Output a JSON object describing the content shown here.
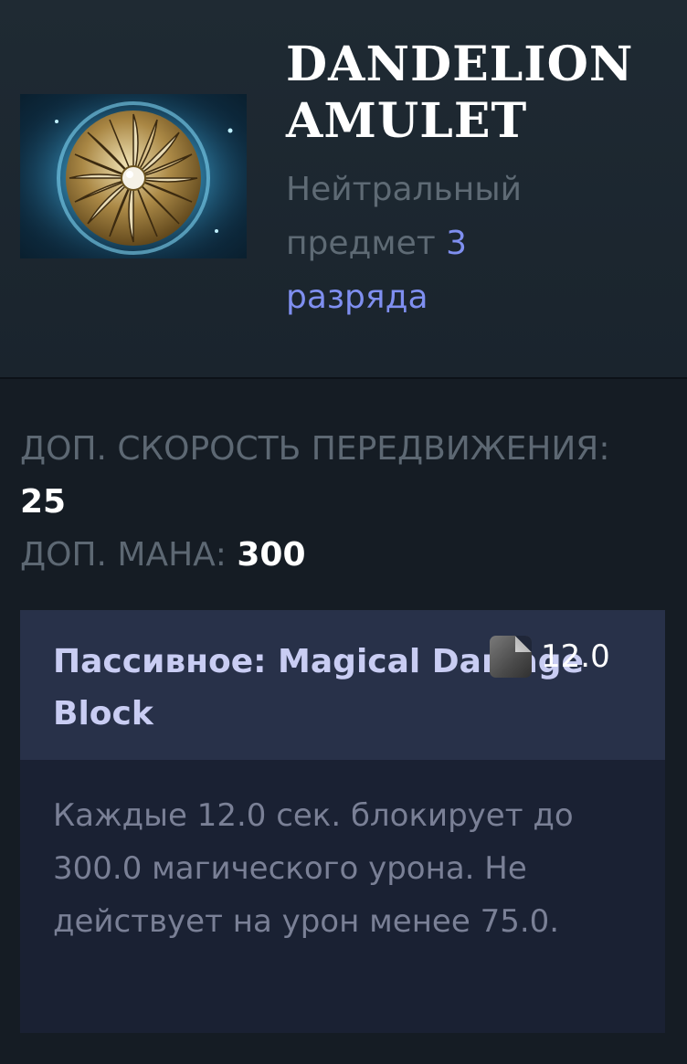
{
  "item": {
    "name": "DANDELION AMULET",
    "type_prefix": "Нейтральный предмет ",
    "tier": "3 разряда",
    "image_icon": "dandelion-amulet-icon"
  },
  "stats": [
    {
      "label": "ДОП. СКОРОСТЬ ПЕРЕДВИЖЕНИЯ: ",
      "value": "25"
    },
    {
      "label": "ДОП. МАНА: ",
      "value": "300"
    }
  ],
  "ability": {
    "title": "Пассивное: Magical Damage Block",
    "cooldown_icon": "cooldown-icon",
    "cooldown": "12.0",
    "description": "Каждые 12.0 сек. блокирует до 300.0 магического урона. Не действует на урон менее 75.0."
  },
  "colors": {
    "background": "#151c24",
    "header": "#1f2a33",
    "tier_accent": "#7f8ff0",
    "ability_title": "#c9cdf3",
    "ability_head_bg": "#283149",
    "ability_body_bg": "#1a2133"
  }
}
